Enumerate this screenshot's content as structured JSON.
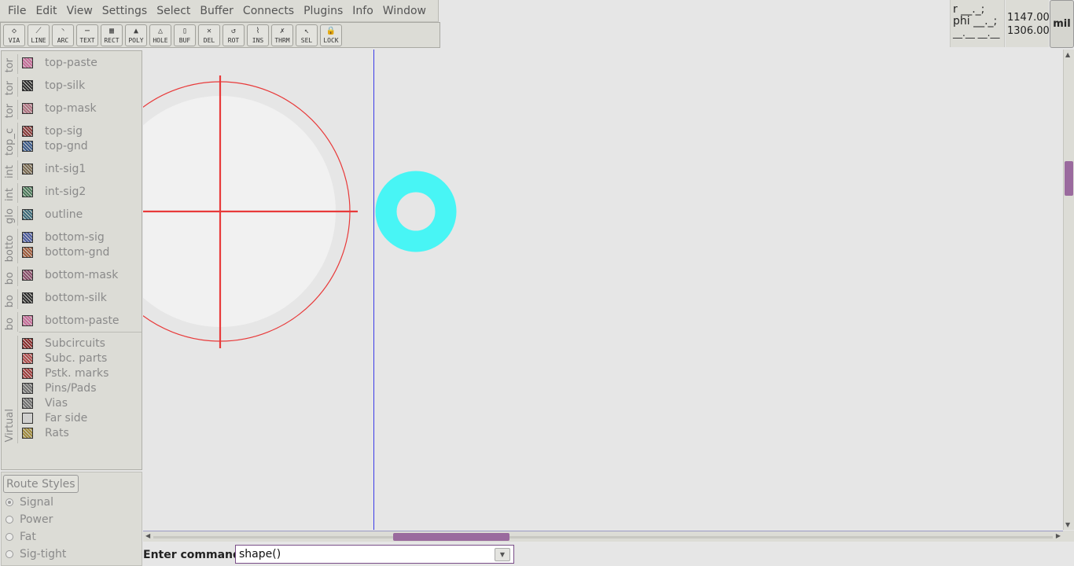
{
  "menu": [
    "File",
    "Edit",
    "View",
    "Settings",
    "Select",
    "Buffer",
    "Connects",
    "Plugins",
    "Info",
    "Window"
  ],
  "toolbar": [
    {
      "label": "VIA",
      "icon": "via-icon"
    },
    {
      "label": "LINE",
      "icon": "line-icon"
    },
    {
      "label": "ARC",
      "icon": "arc-icon"
    },
    {
      "label": "TEXT",
      "icon": "text-icon"
    },
    {
      "label": "RECT",
      "icon": "rect-icon"
    },
    {
      "label": "POLY",
      "icon": "poly-icon"
    },
    {
      "label": "HOLE",
      "icon": "hole-icon"
    },
    {
      "label": "BUF",
      "icon": "buffer-icon"
    },
    {
      "label": "DEL",
      "icon": "delete-icon"
    },
    {
      "label": "ROT",
      "icon": "rotate-icon"
    },
    {
      "label": "INS",
      "icon": "insert-icon"
    },
    {
      "label": "THRM",
      "icon": "thermal-icon"
    },
    {
      "label": "SEL",
      "icon": "select-icon"
    },
    {
      "label": "LOCK",
      "icon": "lock-icon"
    }
  ],
  "status": {
    "polar_r": "r __._;",
    "polar_phi": "phi __._;",
    "polar_extra": "__.__ __.__",
    "x": "1147.00",
    "y": "1306.00",
    "unit": "mil"
  },
  "layer_groups": [
    {
      "tab": "tor",
      "layers": [
        {
          "name": "top-paste",
          "color": "#c86a9a"
        }
      ]
    },
    {
      "tab": "tor",
      "layers": [
        {
          "name": "top-silk",
          "color": "#2e2e2e"
        }
      ]
    },
    {
      "tab": "tor",
      "layers": [
        {
          "name": "top-mask",
          "color": "#b07080"
        }
      ]
    },
    {
      "tab": "top_c",
      "layers": [
        {
          "name": "top-sig",
          "color": "#8b3a3a"
        },
        {
          "name": "top-gnd",
          "color": "#3a5a8b"
        }
      ]
    },
    {
      "tab": "int",
      "layers": [
        {
          "name": "int-sig1",
          "color": "#7a6a50"
        }
      ]
    },
    {
      "tab": "int",
      "layers": [
        {
          "name": "int-sig2",
          "color": "#4a7a5a"
        }
      ]
    },
    {
      "tab": "glo",
      "layers": [
        {
          "name": "outline",
          "color": "#3a6a7a"
        }
      ]
    },
    {
      "tab": "botto",
      "layers": [
        {
          "name": "bottom-sig",
          "color": "#4a5aa0"
        },
        {
          "name": "bottom-gnd",
          "color": "#a05a3a"
        }
      ]
    },
    {
      "tab": "bo",
      "layers": [
        {
          "name": "bottom-mask",
          "color": "#8a4a6a"
        }
      ]
    },
    {
      "tab": "bo",
      "layers": [
        {
          "name": "bottom-silk",
          "color": "#2e2e2e"
        }
      ]
    },
    {
      "tab": "bo",
      "layers": [
        {
          "name": "bottom-paste",
          "color": "#c86a9a"
        }
      ]
    }
  ],
  "virtual_group": {
    "tab": "Virtual",
    "layers": [
      {
        "name": "Subcircuits",
        "color": "#8b2a2a"
      },
      {
        "name": "Subc. parts",
        "color": "#b04a4a"
      },
      {
        "name": "Pstk. marks",
        "color": "#a03a3a"
      },
      {
        "name": "Pins/Pads",
        "color": "#707070"
      },
      {
        "name": "Vias",
        "color": "#707070"
      },
      {
        "name": "Far side",
        "color": "#d0d0d0"
      },
      {
        "name": "Rats",
        "color": "#a08a3a"
      }
    ]
  },
  "route_styles": {
    "button": "Route Styles",
    "styles": [
      {
        "name": "Signal",
        "selected": true
      },
      {
        "name": "Power",
        "selected": false
      },
      {
        "name": "Fat",
        "selected": false
      },
      {
        "name": "Sig-tight",
        "selected": false
      }
    ]
  },
  "canvas": {
    "crosshair_color": "#e83a3a",
    "guide_color": "#3a3ae8",
    "pad_color": "#48f5f5"
  },
  "command": {
    "label": "Enter command:",
    "value": "shape()"
  }
}
